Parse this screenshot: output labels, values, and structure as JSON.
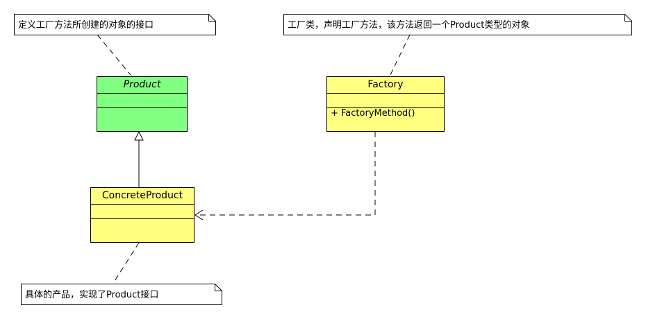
{
  "colors": {
    "interface_fill": "#80ff80",
    "class_fill": "#ffff80",
    "stroke": "#000000",
    "note_fill": "#ffffff"
  },
  "notes": {
    "product": "定义工厂方法所创建的对象的接口",
    "factory": "工厂类，声明工厂方法，该方法返回一个Product类型的对象",
    "concrete": "具体的产品，实现了Product接口"
  },
  "classes": {
    "product": {
      "name": "Product",
      "italic": true
    },
    "factory": {
      "name": "Factory",
      "operation": "+ FactoryMethod()"
    },
    "concrete": {
      "name": "ConcreteProduct"
    }
  }
}
